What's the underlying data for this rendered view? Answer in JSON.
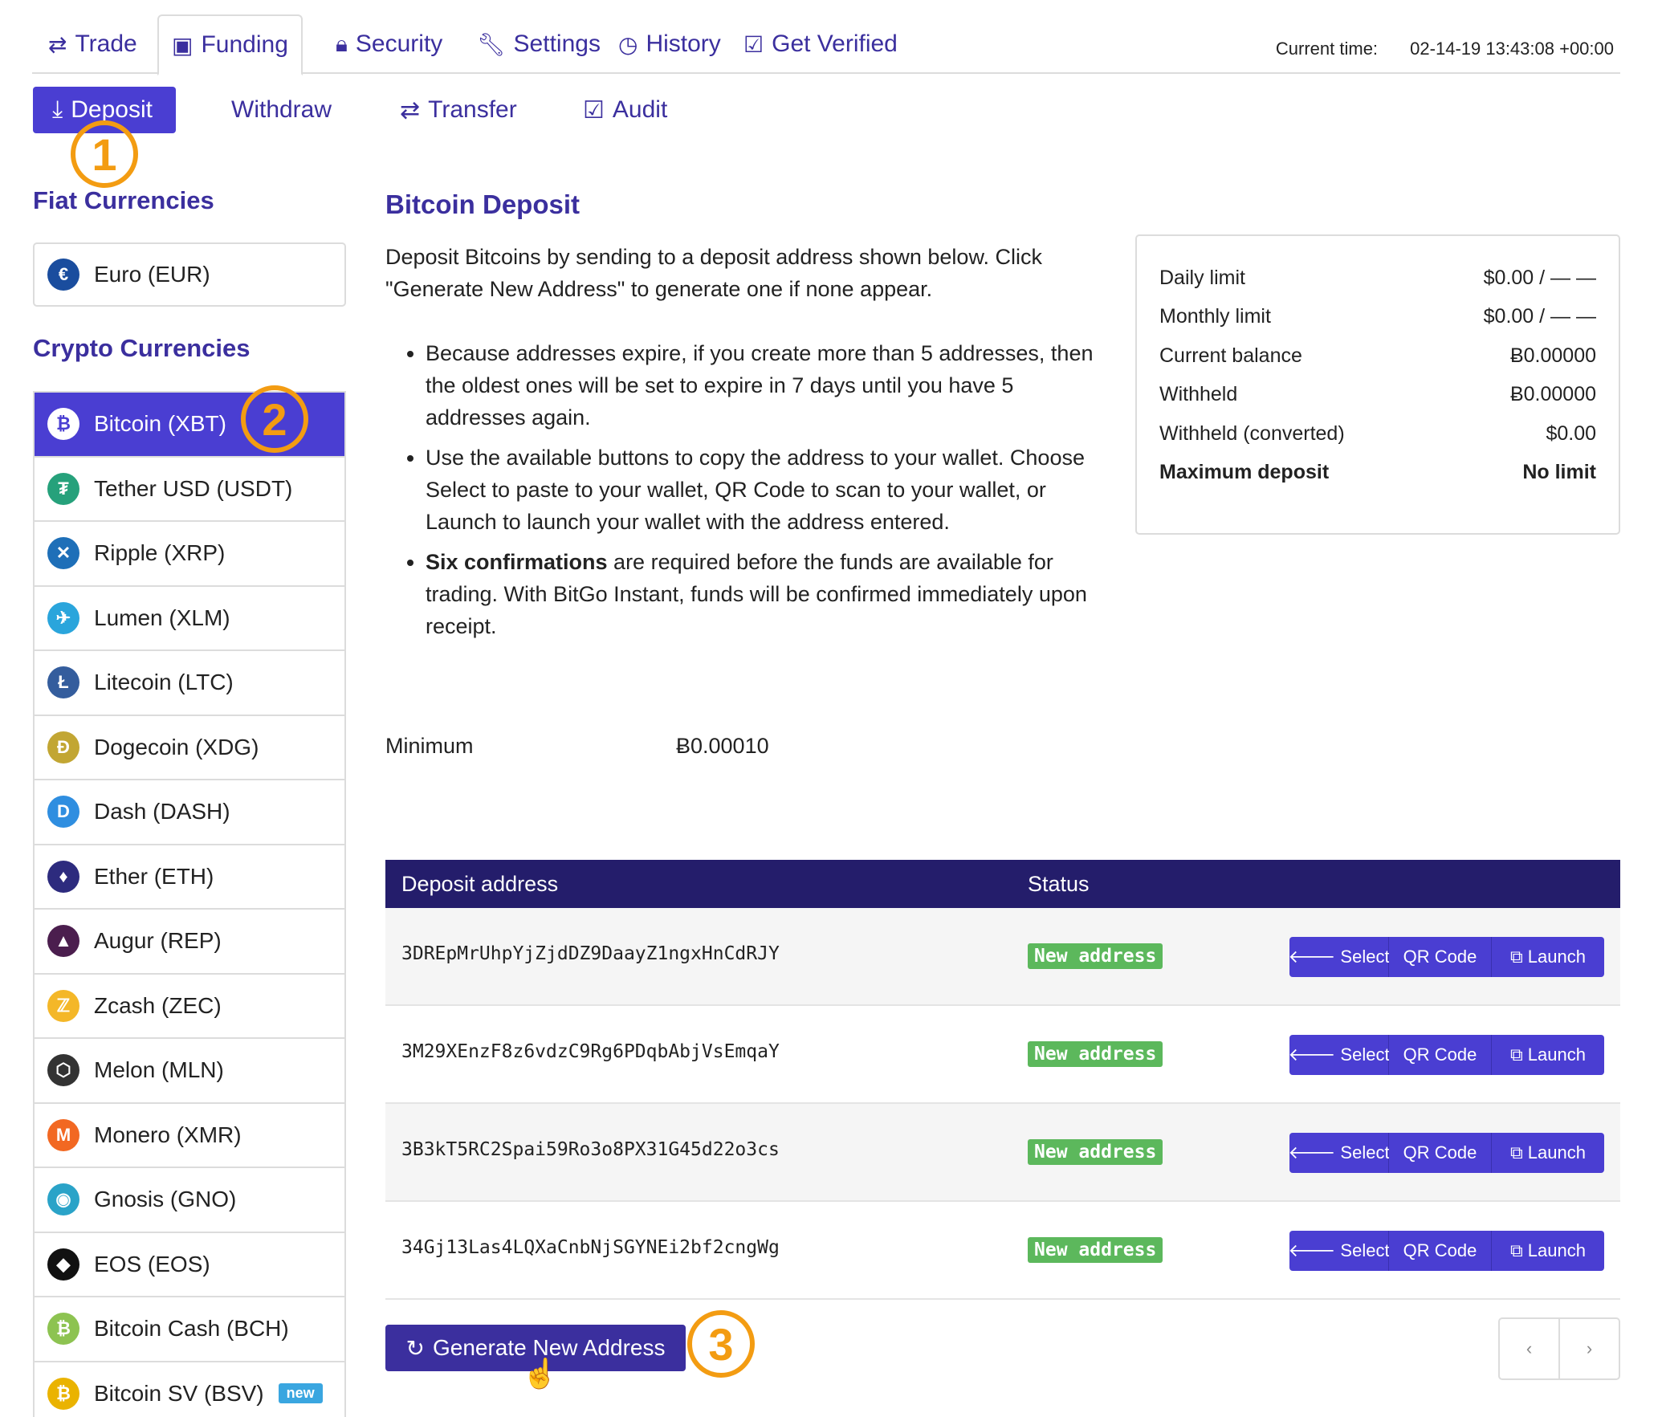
{
  "top_tabs": [
    {
      "label": "Trade",
      "icon": "arrows-icon"
    },
    {
      "label": "Funding",
      "icon": "money-icon"
    },
    {
      "label": "Security",
      "icon": "lock-icon"
    },
    {
      "label": "Settings",
      "icon": "wrench-icon"
    },
    {
      "label": "History",
      "icon": "clock-icon"
    },
    {
      "label": "Get Verified",
      "icon": "check-square-icon"
    }
  ],
  "current_time": {
    "label": "Current time:",
    "value": "02-14-19 13:43:08 +00:00"
  },
  "sub_tabs": [
    {
      "label": "Deposit",
      "icon": "download-icon"
    },
    {
      "label": "Withdraw"
    },
    {
      "label": "Transfer",
      "icon": "exchange-icon"
    },
    {
      "label": "Audit",
      "icon": "check-square-icon"
    }
  ],
  "callouts": [
    "1",
    "2",
    "3"
  ],
  "sidebar": {
    "fiat_title": "Fiat Currencies",
    "fiat": [
      {
        "label": "Euro (EUR)",
        "glyph": "€",
        "color": "#1a4d9e"
      }
    ],
    "crypto_title": "Crypto Currencies",
    "crypto": [
      {
        "label": "Bitcoin (XBT)",
        "glyph": "₿",
        "color": "#4a3ed2"
      },
      {
        "label": "Tether USD (USDT)",
        "glyph": "₮",
        "color": "#26a17b"
      },
      {
        "label": "Ripple (XRP)",
        "glyph": "✕",
        "color": "#1e6fb8"
      },
      {
        "label": "Lumen (XLM)",
        "glyph": "✈",
        "color": "#2aa5dc"
      },
      {
        "label": "Litecoin (LTC)",
        "glyph": "Ł",
        "color": "#345d9d"
      },
      {
        "label": "Dogecoin (XDG)",
        "glyph": "Ð",
        "color": "#c2a633"
      },
      {
        "label": "Dash (DASH)",
        "glyph": "D",
        "color": "#2f8ee0"
      },
      {
        "label": "Ether (ETH)",
        "glyph": "♦",
        "color": "#2d2b7e"
      },
      {
        "label": "Augur (REP)",
        "glyph": "▲",
        "color": "#4b1e4e"
      },
      {
        "label": "Zcash (ZEC)",
        "glyph": "ℤ",
        "color": "#f4b728"
      },
      {
        "label": "Melon (MLN)",
        "glyph": "⬡",
        "color": "#333333"
      },
      {
        "label": "Monero (XMR)",
        "glyph": "M",
        "color": "#f26822"
      },
      {
        "label": "Gnosis (GNO)",
        "glyph": "◉",
        "color": "#2aa3c8"
      },
      {
        "label": "EOS (EOS)",
        "glyph": "◆",
        "color": "#111111"
      },
      {
        "label": "Bitcoin Cash (BCH)",
        "glyph": "₿",
        "color": "#8dc351"
      },
      {
        "label": "Bitcoin SV (BSV)",
        "glyph": "₿",
        "color": "#eab300",
        "badge": "new"
      }
    ]
  },
  "main": {
    "title": "Bitcoin Deposit",
    "intro": "Deposit Bitcoins by sending to a deposit address shown below. Click \"Generate New Address\" to generate one if none appear.",
    "bullet1": "Because addresses expire, if you create more than 5 addresses, then the oldest ones will be set to expire in 7 days until you have 5 addresses again.",
    "bullet2": "Use the available buttons to copy the address to your wallet. Choose Select to paste to your wallet, QR Code to scan to your wallet, or Launch to launch your wallet with the address entered.",
    "bullet3_bold": "Six confirmations",
    "bullet3_rest": " are required before the funds are available for trading. With BitGo Instant, funds will be confirmed immediately upon receipt.",
    "minimum_label": "Minimum",
    "minimum_value": "Ƀ0.00010"
  },
  "limits": [
    {
      "label": "Daily limit",
      "value": "$0.00 / — —"
    },
    {
      "label": "Monthly limit",
      "value": "$0.00 / — —"
    },
    {
      "label": "Current balance",
      "value": "Ƀ0.00000"
    },
    {
      "label": "Withheld",
      "value": "Ƀ0.00000"
    },
    {
      "label": "Withheld (converted)",
      "value": "$0.00"
    },
    {
      "label": "Maximum deposit",
      "value": "No limit",
      "bold": true
    }
  ],
  "table": {
    "headers": [
      "Deposit address",
      "Status"
    ],
    "rows": [
      {
        "address": "3DREpMrUhpYjZjdDZ9DaayZ1ngxHnCdRJY",
        "status": "New address"
      },
      {
        "address": "3M29XEnzF8z6vdzC9Rg6PDqbAbjVsEmqaY",
        "status": "New address"
      },
      {
        "address": "3B3kT5RC2Spai59Ro3o8PX31G45d22o3cs",
        "status": "New address"
      },
      {
        "address": "34Gj13Las4LQXaCnbNjSGYNEi2bf2cngWg",
        "status": "New address"
      }
    ],
    "buttons": {
      "select": "Select",
      "qr": "QR Code",
      "launch": "Launch"
    }
  },
  "generate_button": "Generate New Address",
  "pager": {
    "prev": "‹",
    "next": "›"
  }
}
